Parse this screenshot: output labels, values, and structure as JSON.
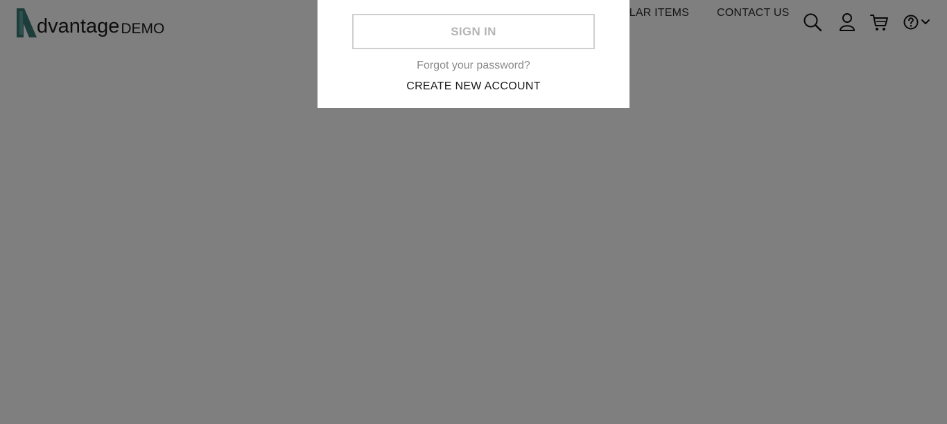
{
  "header": {
    "logo": {
      "text": "dvantage",
      "sub": "DEMO"
    },
    "nav": [
      {
        "label": "POPULAR ITEMS"
      },
      {
        "label": "CONTACT US"
      }
    ],
    "icons": [
      "search-icon",
      "user-icon",
      "cart-icon",
      "help-icon",
      "chevron-down-icon"
    ]
  },
  "login": {
    "sign_in_label": "SIGN IN",
    "forgot_label": "Forgot your password?",
    "create_label": "CREATE NEW ACCOUNT"
  },
  "colors": {
    "brand": "#3a7a76",
    "overlay": "rgba(0,0,0,0.5)",
    "signin_text": "#b5b5b5"
  }
}
